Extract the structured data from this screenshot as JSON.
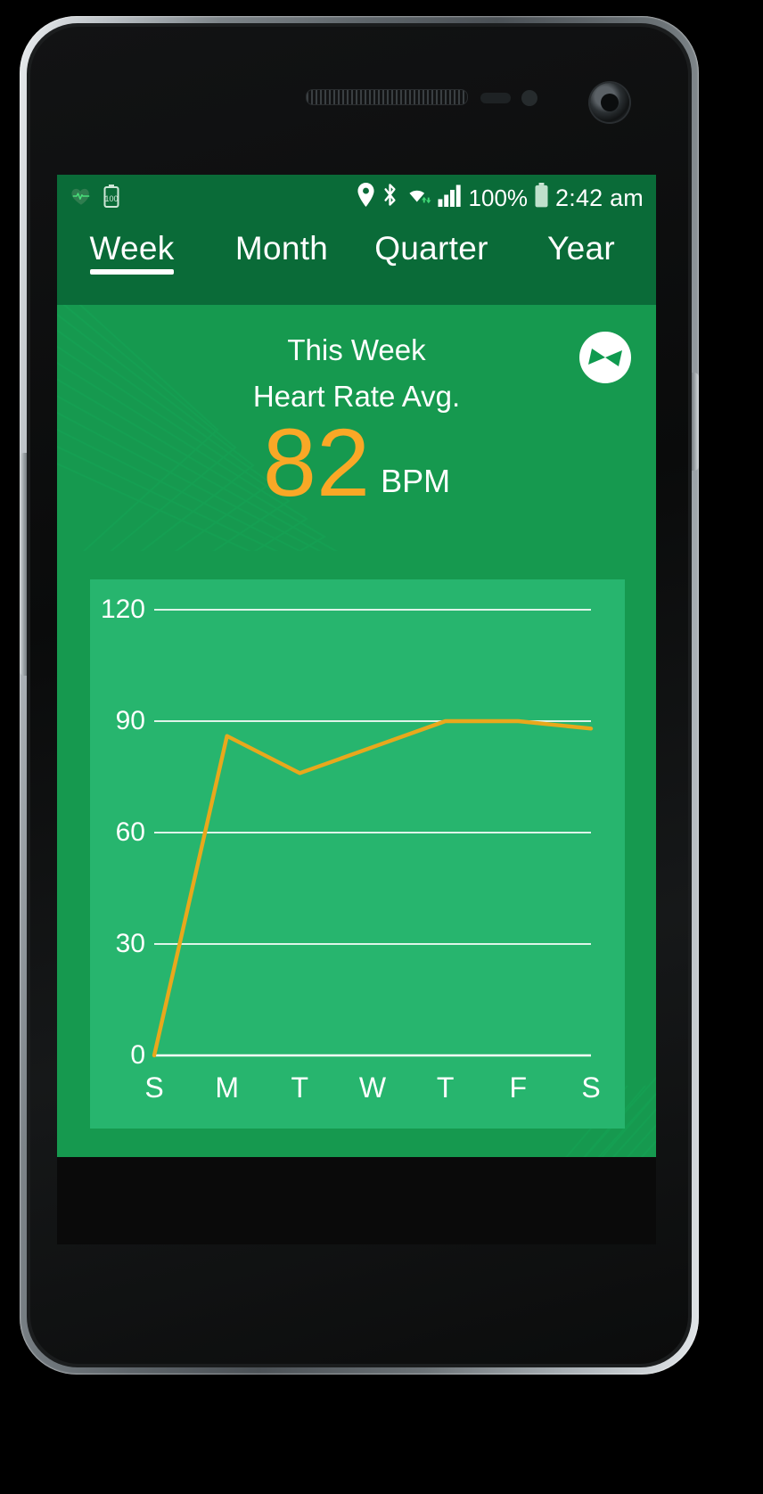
{
  "status_bar": {
    "notification_icons": [
      "heart-rate-icon",
      "battery-saver-icon"
    ],
    "system_icons": [
      "location-icon",
      "bluetooth-icon",
      "wifi-icon",
      "signal-icon"
    ],
    "battery_percent": "100%",
    "time": "2:42 am"
  },
  "tabs": [
    {
      "label": "Week",
      "active": true
    },
    {
      "label": "Month",
      "active": false
    },
    {
      "label": "Quarter",
      "active": false
    },
    {
      "label": "Year",
      "active": false
    }
  ],
  "hero": {
    "title": "This Week",
    "subtitle": "Heart Rate Avg.",
    "value": "82",
    "unit": "BPM",
    "logo_icon": "pinwheel-brand-logo",
    "accent_color": "#F9A826",
    "background_color": "#16994F",
    "header_color": "#0A6B38"
  },
  "chart_data": {
    "type": "line",
    "title": "This Week Heart Rate Avg.",
    "xlabel": "",
    "ylabel": "BPM",
    "categories": [
      "S",
      "M",
      "T",
      "W",
      "T",
      "F",
      "S"
    ],
    "values": [
      0,
      86,
      76,
      83,
      90,
      90,
      88
    ],
    "series": [
      {
        "name": "Heart Rate Avg.",
        "values": [
          0,
          86,
          76,
          83,
          90,
          90,
          88
        ],
        "color": "#E8A81C"
      }
    ],
    "ylim": [
      0,
      120
    ],
    "yticks": [
      0,
      30,
      60,
      90,
      120
    ],
    "ytick_labels": [
      "0",
      "30",
      "60",
      "90",
      "120"
    ],
    "grid": true,
    "gridline_color": "#FFFFFF",
    "legend": "none",
    "plot_background": "#27B56E"
  }
}
